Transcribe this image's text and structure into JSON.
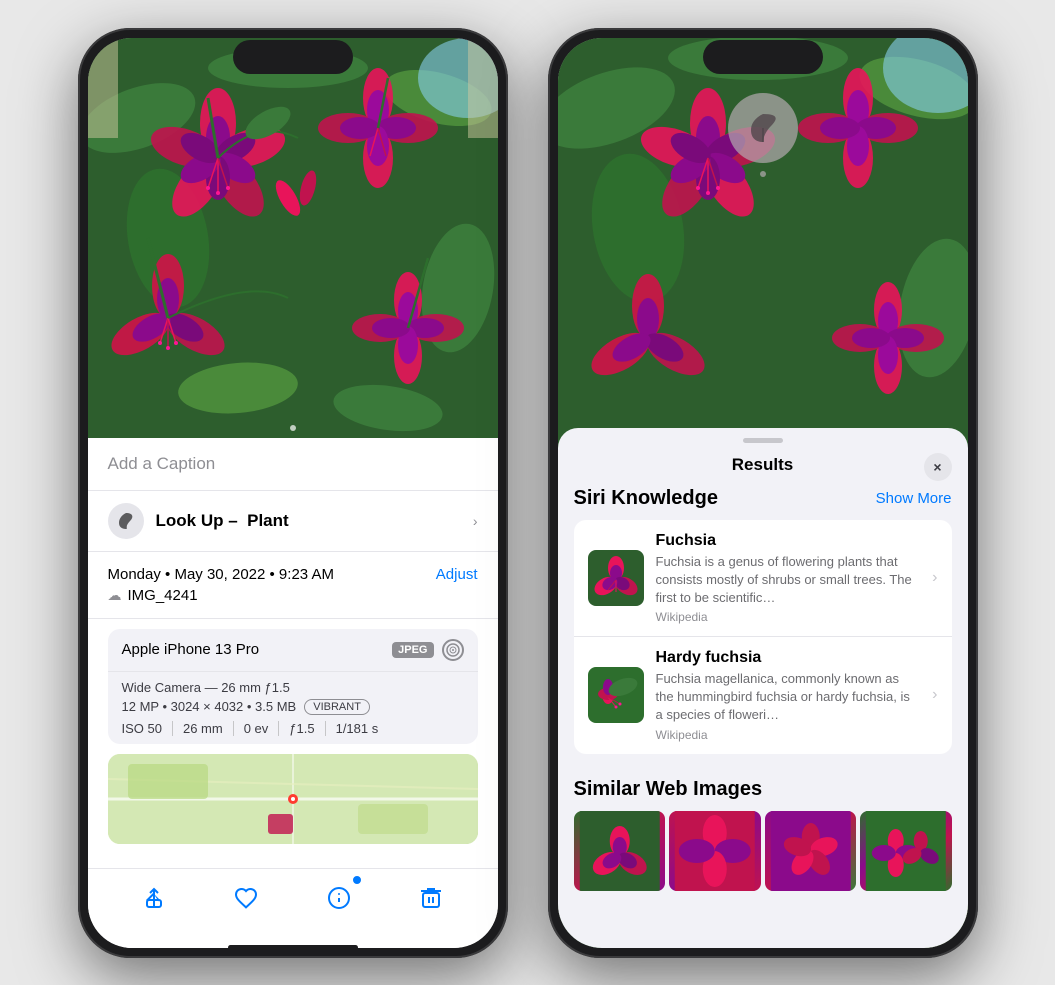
{
  "left_phone": {
    "caption_placeholder": "Add a Caption",
    "lookup_label": "Look Up –",
    "lookup_type": "Plant",
    "date": "Monday • May 30, 2022 • 9:23 AM",
    "adjust_label": "Adjust",
    "filename": "IMG_4241",
    "camera_name": "Apple iPhone 13 Pro",
    "jpeg_label": "JPEG",
    "wide_camera": "Wide Camera — 26 mm ƒ1.5",
    "mp_info": "12 MP  •  3024 × 4032  •  3.5 MB",
    "vibrant_label": "VIBRANT",
    "iso": "ISO 50",
    "focal": "26 mm",
    "ev": "0 ev",
    "aperture": "ƒ1.5",
    "shutter": "1/181 s",
    "toolbar": {
      "share": "⬆",
      "heart": "♡",
      "info": "ℹ",
      "trash": "🗑"
    }
  },
  "right_phone": {
    "results_title": "Results",
    "close_label": "×",
    "siri_knowledge_title": "Siri Knowledge",
    "show_more_label": "Show More",
    "items": [
      {
        "name": "Fuchsia",
        "description": "Fuchsia is a genus of flowering plants that consists mostly of shrubs or small trees. The first to be scientific…",
        "source": "Wikipedia"
      },
      {
        "name": "Hardy fuchsia",
        "description": "Fuchsia magellanica, commonly known as the hummingbird fuchsia or hardy fuchsia, is a species of floweri…",
        "source": "Wikipedia"
      }
    ],
    "similar_web_title": "Similar Web Images",
    "leaf_icon": "🌿"
  }
}
